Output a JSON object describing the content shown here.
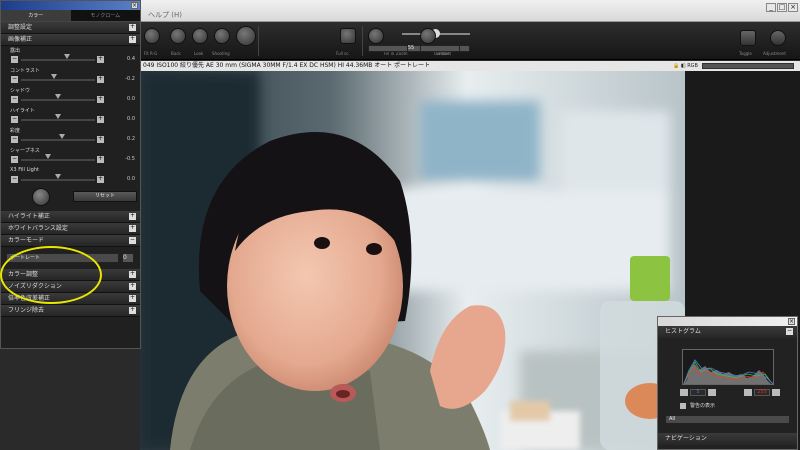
{
  "menu": {
    "help": "ヘルプ (H)"
  },
  "toolbar": {
    "labels": [
      "Fit R-G",
      "Back",
      "Look",
      "Shooting",
      "Zoom",
      "Contrast",
      "Full sc.",
      "Fill in",
      "Create",
      "Toggle",
      "Adjustment"
    ],
    "zoom_field": "F55",
    "rt_icons": [
      "toggle-icon",
      "adjustment-icon"
    ]
  },
  "info": {
    "text": "049  ISO100  絞り優先 AE  30 mm  (SIGMA 30MM F/1.4 EX DC HSM)  HI  44.36MB  オート  ポートレート",
    "icons": "🔒 ◧ RGB"
  },
  "left_panel": {
    "tabs": [
      {
        "label": "カラー",
        "active": true
      },
      {
        "label": "モノクローム",
        "active": false
      }
    ],
    "sections_top": [
      {
        "label": "調整設定",
        "toggle": "+"
      },
      {
        "label": "画像補正",
        "toggle": "+"
      }
    ],
    "adjustments": [
      {
        "label": "露出",
        "value": "0.4",
        "pos": 0.62
      },
      {
        "label": "コントラスト",
        "value": "-0.2",
        "pos": 0.45
      },
      {
        "label": "シャドウ",
        "value": "0.0",
        "pos": 0.5
      },
      {
        "label": "ハイライト",
        "value": "0.0",
        "pos": 0.5
      },
      {
        "label": "彩度",
        "value": "0.2",
        "pos": 0.56
      },
      {
        "label": "シャープネス",
        "value": "-0.5",
        "pos": 0.36
      },
      {
        "label": "X3 Fill Light",
        "value": "0.0",
        "pos": 0.5
      }
    ],
    "reset_label": "リセット",
    "sections_mid": [
      {
        "label": "ハイライト補正",
        "toggle": "+"
      },
      {
        "label": "ホワイトバランス設定",
        "toggle": "+"
      },
      {
        "label": "カラーモード",
        "toggle": "−"
      }
    ],
    "color_mode_value": "ポートレート",
    "color_mode_btn": "0",
    "sections_bottom": [
      {
        "label": "カラー調整",
        "toggle": "+"
      },
      {
        "label": "ノイズリダクション",
        "toggle": "+"
      },
      {
        "label": "倍率色収差補正",
        "toggle": "+"
      },
      {
        "label": "フリンジ除去",
        "toggle": "+"
      }
    ]
  },
  "histogram_panel": {
    "title": "ヒストグラム",
    "toggle": "−",
    "left_value": "5",
    "right_value": "255",
    "warning_label": "警告の表示",
    "channel_value": "All",
    "nav_label": "ナビゲーション",
    "colors": {
      "left_value": "#4a7bdc",
      "right_value": "#e03030"
    }
  },
  "colors": {
    "ellipse": "#e9e600",
    "title_bar": "#1c3d8c"
  }
}
